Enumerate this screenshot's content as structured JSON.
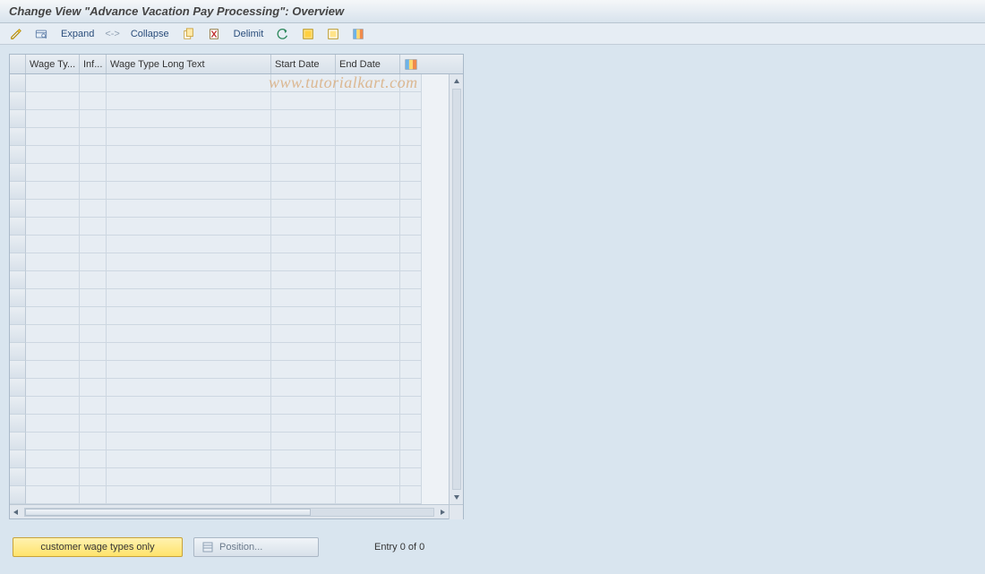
{
  "header": {
    "title": "Change View \"Advance Vacation Pay Processing\": Overview"
  },
  "toolbar": {
    "expand_label": "Expand",
    "separator_label": "<->",
    "collapse_label": "Collapse",
    "delimit_label": "Delimit"
  },
  "table": {
    "columns": {
      "wage_type": "Wage Ty...",
      "info": "Inf...",
      "long_text": "Wage Type Long Text",
      "start_date": "Start Date",
      "end_date": "End Date"
    },
    "rows": []
  },
  "footer": {
    "customer_button": "customer wage types only",
    "position_button": "Position...",
    "entry_text": "Entry 0 of 0"
  },
  "watermark": "www.tutorialkart.com"
}
